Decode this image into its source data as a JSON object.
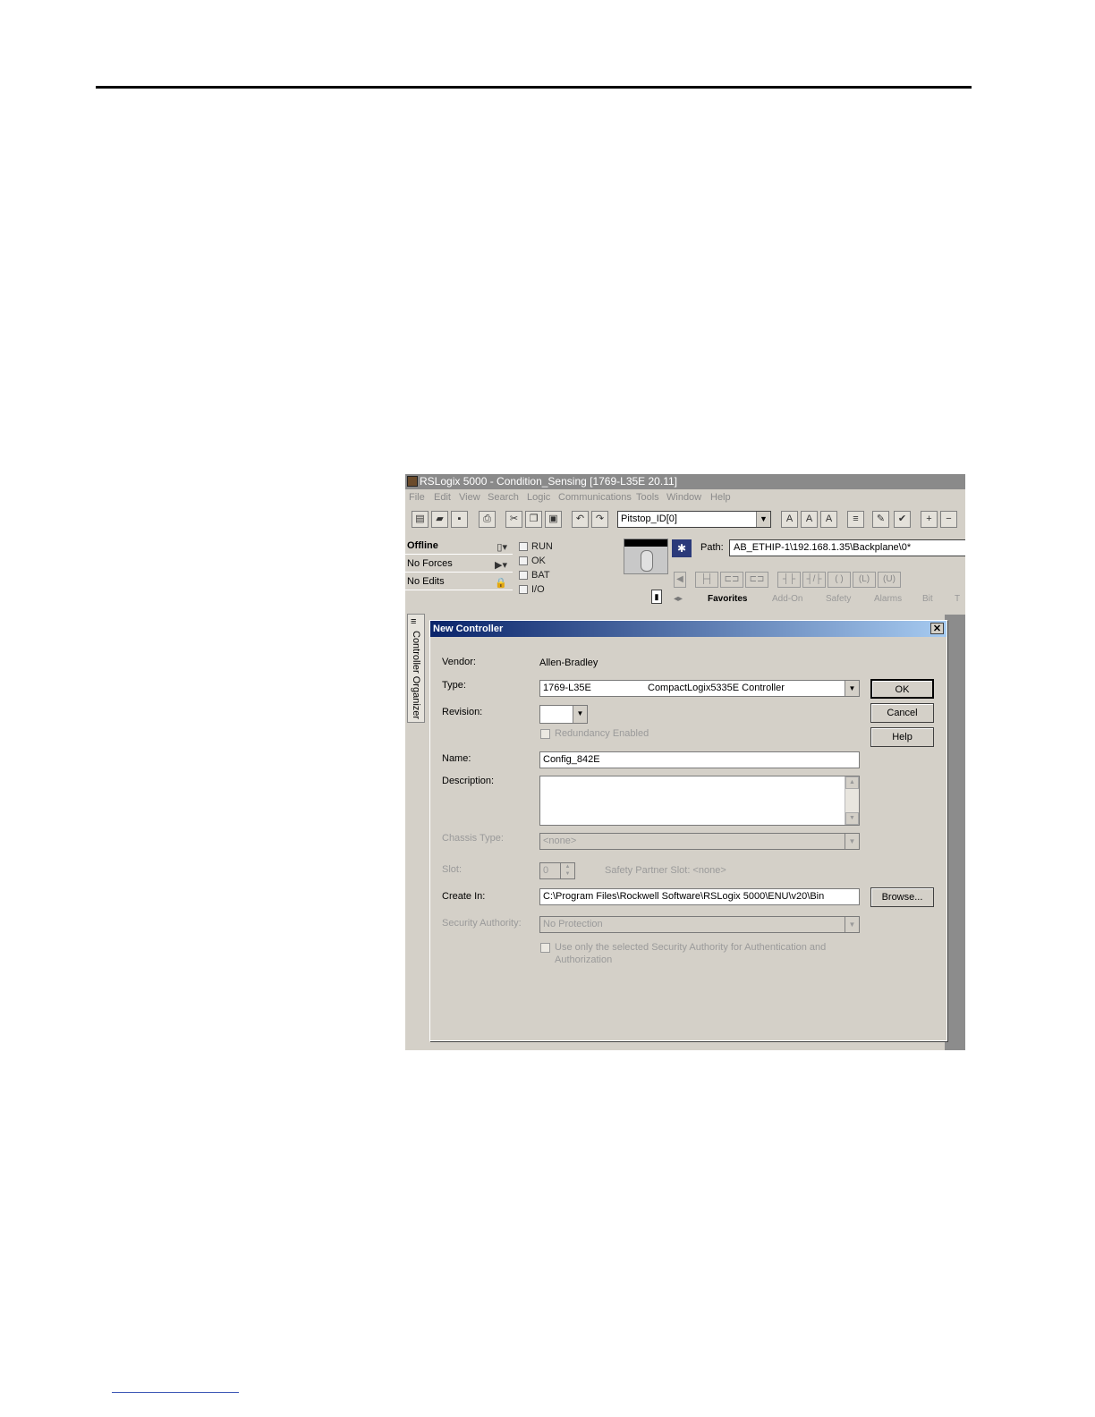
{
  "window": {
    "title": "RSLogix 5000 - Condition_Sensing [1769-L35E 20.11]"
  },
  "menu": [
    "File",
    "Edit",
    "View",
    "Search",
    "Logic",
    "Communications",
    "Tools",
    "Window",
    "Help"
  ],
  "toolbar": {
    "routine_combo_value": "Pitstop_ID[0]"
  },
  "status": {
    "mode": "Offline",
    "forces": "No Forces",
    "edits": "No Edits",
    "leds": [
      "RUN",
      "OK",
      "BAT",
      "I/O"
    ]
  },
  "path": {
    "label": "Path:",
    "value": "AB_ETHIP-1\\192.168.1.35\\Backplane\\0*"
  },
  "instruction_tabs": [
    "Favorites",
    "Add-On",
    "Safety",
    "Alarms",
    "Bit",
    "T"
  ],
  "organizer": {
    "label": "Controller Organizer"
  },
  "dialog": {
    "title": "New Controller",
    "vendor_label": "Vendor:",
    "vendor_value": "Allen-Bradley",
    "type_label": "Type:",
    "type_code": "1769-L35E",
    "type_desc": "CompactLogix5335E Controller",
    "revision_label": "Revision:",
    "revision_value": "",
    "redundancy_label": "Redundancy Enabled",
    "name_label": "Name:",
    "name_value": "Config_842E",
    "description_label": "Description:",
    "description_value": "",
    "chassis_label": "Chassis Type:",
    "chassis_value": "<none>",
    "slot_label": "Slot:",
    "slot_value": "0",
    "safety_partner": "Safety Partner Slot: <none>",
    "create_in_label": "Create In:",
    "create_in_value": "C:\\Program Files\\Rockwell Software\\RSLogix 5000\\ENU\\v20\\Bin",
    "security_label": "Security Authority:",
    "security_value": "No Protection",
    "security_check_line1": "Use only the selected Security Authority for Authentication and",
    "security_check_line2": "Authorization",
    "buttons": {
      "ok": "OK",
      "cancel": "Cancel",
      "help": "Help",
      "browse": "Browse..."
    }
  }
}
